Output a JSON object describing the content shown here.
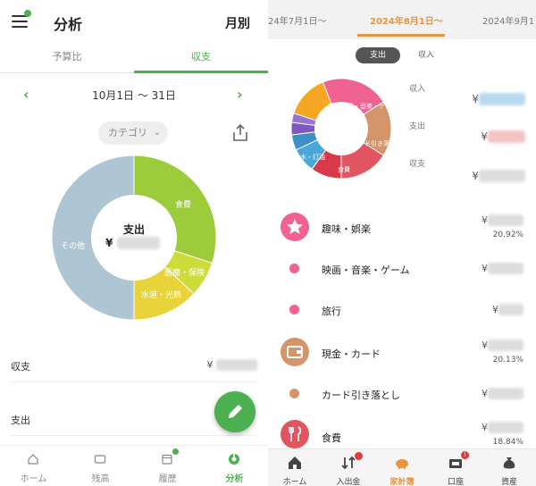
{
  "left": {
    "header": {
      "title": "分析",
      "period": "月別"
    },
    "tabs": [
      {
        "label": "予算比",
        "active": false
      },
      {
        "label": "収支",
        "active": true
      }
    ],
    "range": "10月1日 〜 31日",
    "category_button": "カテゴリ",
    "donut": {
      "center_label": "支出",
      "center_currency": "¥",
      "segments": [
        {
          "label": "食費",
          "color": "#9ccc3a",
          "fraction": 0.3
        },
        {
          "label": "医療・保険",
          "color": "#cddc39",
          "fraction": 0.07
        },
        {
          "label": "水道・光熱",
          "color": "#e8d43a",
          "fraction": 0.13
        },
        {
          "label": "その他",
          "color": "#aec5d4",
          "fraction": 0.5
        }
      ]
    },
    "rows": [
      {
        "label": "収支",
        "value": "¥"
      },
      {
        "label": "支出",
        "value": ""
      }
    ],
    "nav": [
      {
        "label": "ホーム",
        "icon": "home-icon",
        "active": false
      },
      {
        "label": "残高",
        "icon": "wallet-icon",
        "active": false
      },
      {
        "label": "履歴",
        "icon": "calendar-icon",
        "active": false
      },
      {
        "label": "分析",
        "icon": "analysis-icon",
        "active": true
      }
    ]
  },
  "right": {
    "months": [
      "24年7月1日〜",
      "2024年8月1日〜",
      "2024年9月1"
    ],
    "toggle": [
      {
        "label": "支出",
        "active": true
      },
      {
        "label": "収入",
        "active": false
      }
    ],
    "summary": [
      {
        "label": "収入",
        "currency": "¥",
        "color": "#4a9fd8"
      },
      {
        "label": "支出",
        "currency": "¥",
        "color": "#e57373"
      },
      {
        "label": "収支",
        "currency": "¥",
        "color": "#777777"
      }
    ],
    "donut": {
      "labels": [
        "未分類",
        "映画・音楽・ゲ",
        "ド引き落",
        "食費",
        "水・灯油"
      ],
      "segments": [
        {
          "color": "#f06292",
          "fraction": 0.22
        },
        {
          "color": "#d4956a",
          "fraction": 0.18
        },
        {
          "color": "#e05560",
          "fraction": 0.16
        },
        {
          "color": "#d93a4a",
          "fraction": 0.1
        },
        {
          "color": "#4aa8d8",
          "fraction": 0.08
        },
        {
          "color": "#3e8fc7",
          "fraction": 0.05
        },
        {
          "color": "#7e57c2",
          "fraction": 0.04
        },
        {
          "color": "#9575cd",
          "fraction": 0.03
        },
        {
          "color": "#f5a623",
          "fraction": 0.14
        }
      ]
    },
    "categories": [
      {
        "name": "趣味・娯楽",
        "amount": "¥",
        "percent": "20.92%",
        "kind": "icon",
        "color": "#f06292",
        "icon": "star-icon"
      },
      {
        "name": "映画・音楽・ゲーム",
        "amount": "¥",
        "percent": "",
        "kind": "dot",
        "color": "#f06292"
      },
      {
        "name": "旅行",
        "amount": "¥",
        "percent": "",
        "kind": "dot",
        "color": "#f06292"
      },
      {
        "name": "現金・カード",
        "amount": "¥",
        "percent": "20.13%",
        "kind": "icon",
        "color": "#d4956a",
        "icon": "wallet-icon"
      },
      {
        "name": "カード引き落とし",
        "amount": "¥",
        "percent": "",
        "kind": "dot",
        "color": "#d4956a"
      },
      {
        "name": "食費",
        "amount": "¥",
        "percent": "18.84%",
        "kind": "icon",
        "color": "#e05560",
        "icon": "fork-knife-icon"
      }
    ],
    "nav": [
      {
        "label": "ホーム",
        "icon": "home-icon",
        "active": false
      },
      {
        "label": "入出金",
        "icon": "transfer-icon",
        "active": false
      },
      {
        "label": "家計簿",
        "icon": "piggy-bank-icon",
        "active": true
      },
      {
        "label": "口座",
        "icon": "bank-icon",
        "active": false,
        "badge": "!"
      },
      {
        "label": "資産",
        "icon": "money-bag-icon",
        "active": false
      }
    ]
  }
}
